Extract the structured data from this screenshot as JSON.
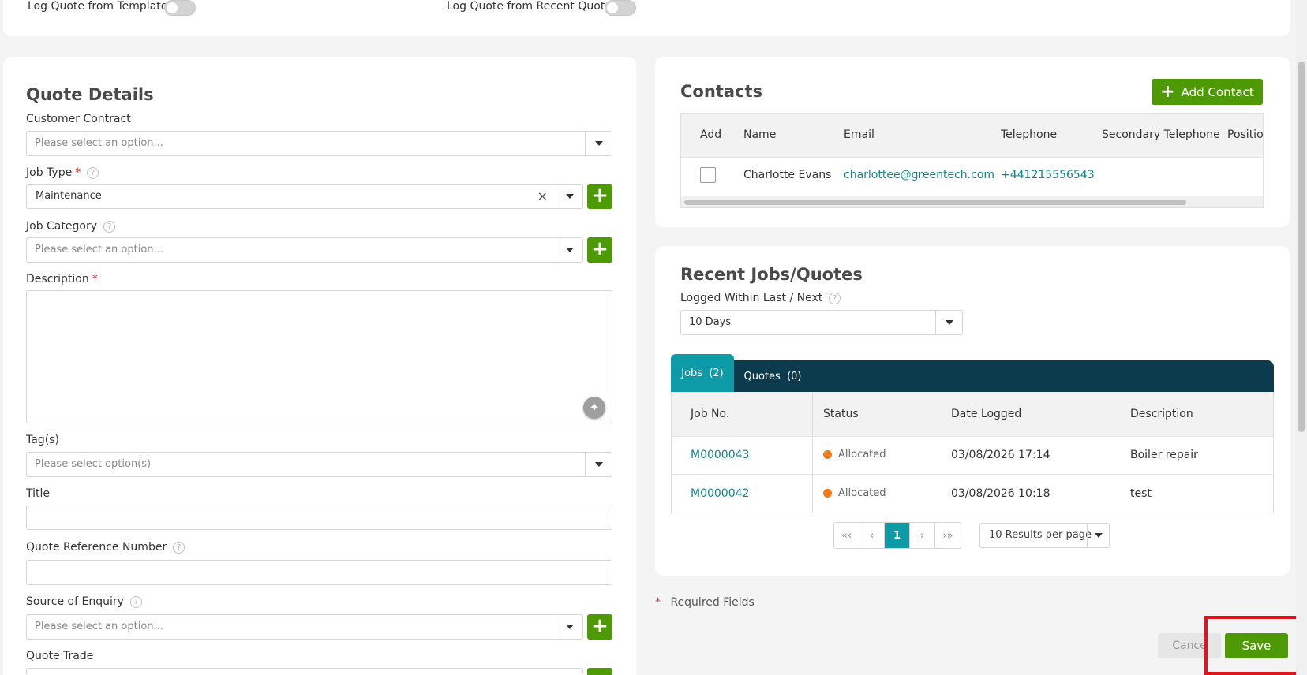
{
  "top": {
    "template_toggle_label": "Log Quote from Template",
    "recent_toggle_label": "Log Quote from Recent Quote"
  },
  "quote_details": {
    "title": "Quote Details",
    "customer_contract": {
      "label": "Customer Contract",
      "placeholder": "Please select an option..."
    },
    "job_type": {
      "label": "Job Type",
      "required_mark": "*",
      "value": "Maintenance",
      "clear": "×"
    },
    "job_category": {
      "label": "Job Category",
      "placeholder": "Please select an option..."
    },
    "description": {
      "label": "Description",
      "required_mark": "*",
      "value": ""
    },
    "tags": {
      "label": "Tag(s)",
      "placeholder": "Please select option(s)"
    },
    "title_field": {
      "label": "Title",
      "value": ""
    },
    "quote_reference": {
      "label": "Quote Reference Number",
      "value": ""
    },
    "source_of_enquiry": {
      "label": "Source of Enquiry",
      "placeholder": "Please select an option..."
    },
    "quote_trade": {
      "label": "Quote Trade"
    },
    "help_glyph": "?",
    "plus_glyph": "+"
  },
  "contacts": {
    "title": "Contacts",
    "add_button": "Add Contact",
    "columns": [
      "Add",
      "Name",
      "Email",
      "Telephone",
      "Secondary Telephone",
      "Position"
    ],
    "rows": [
      {
        "name": "Charlotte Evans",
        "email": "charlottee@greentech.com",
        "telephone": "+441215556543",
        "secondary": "",
        "position": ""
      }
    ]
  },
  "recent": {
    "title": "Recent Jobs/Quotes",
    "logged_label": "Logged Within Last / Next",
    "logged_value": "10 Days",
    "tabs": [
      {
        "label": "Jobs",
        "count": "(2)"
      },
      {
        "label": "Quotes",
        "count": "(0)"
      }
    ],
    "columns": [
      "Job No.",
      "Status",
      "Date Logged",
      "Description"
    ],
    "rows": [
      {
        "job_no": "M0000043",
        "status": "Allocated",
        "date": "03/08/2026 17:14",
        "description": "Boiler repair"
      },
      {
        "job_no": "M0000042",
        "status": "Allocated",
        "date": "03/08/2026 10:18",
        "description": "test"
      }
    ],
    "pager": {
      "first": "«‹",
      "prev": "‹",
      "page": "1",
      "next": "›",
      "last": "›»",
      "per_page": "10 Results per page"
    },
    "status_color": "#f07d1a"
  },
  "footer": {
    "required_mark": "*",
    "required_text": "Required Fields",
    "cancel": "Cance",
    "save": "Save"
  },
  "colors": {
    "brand_green": "#4e9a06",
    "teal": "#0e9aa7",
    "navy": "#0b3b4d",
    "highlight_red": "#e0141c"
  }
}
